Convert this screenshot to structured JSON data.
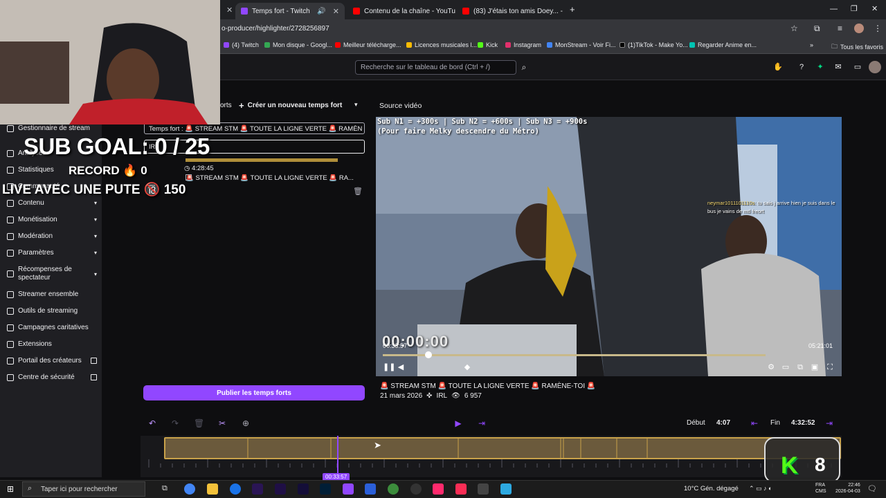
{
  "browser": {
    "tabs": [
      {
        "label": "Temps fort - Twitch",
        "color": "#9147ff",
        "active": true
      },
      {
        "label": "Contenu de la chaîne - YouTub",
        "color": "#ff0000",
        "active": false
      },
      {
        "label": "(83) J'étais ton amis Doey... - Pu",
        "color": "#ff0000",
        "active": false
      }
    ],
    "url": "o-producer/highlighter/2728256897",
    "bookmarks": [
      {
        "label": "(4) Twitch",
        "color": "#9147ff"
      },
      {
        "label": "Mon disque - Googl...",
        "color": "#34a853"
      },
      {
        "label": "Meilleur télécharge...",
        "color": "#ff0000"
      },
      {
        "label": "Licences musicales l...",
        "color": "#fbbc04"
      },
      {
        "label": "Kick",
        "color": "#53fc18"
      },
      {
        "label": "Instagram",
        "color": "#e1306c"
      },
      {
        "label": "MonStream - Voir Fi...",
        "color": "#4285f4"
      },
      {
        "label": "(1)TikTok - Make Yo...",
        "color": "#000000"
      },
      {
        "label": "Regarder Anime en...",
        "color": "#00c4b3"
      }
    ],
    "all_favorites": "Tous les favoris"
  },
  "topbar": {
    "search_placeholder": "Recherche sur le tableau de bord (Ctrl + /)"
  },
  "sidebar": {
    "items": [
      {
        "label": "Gestionnaire de stream",
        "chevron": false
      },
      {
        "label": "Analyses",
        "chevron": false
      },
      {
        "label": "Statistiques",
        "chevron": false
      },
      {
        "label": "Communauté",
        "chevron": false
      },
      {
        "label": "Contenu",
        "chevron": true
      },
      {
        "label": "Monétisation",
        "chevron": true
      },
      {
        "label": "Modération",
        "chevron": true
      },
      {
        "label": "Paramètres",
        "chevron": true
      },
      {
        "label": "Récompenses de spectateur",
        "chevron": true
      },
      {
        "label": "Streamer ensemble",
        "chevron": false
      },
      {
        "label": "Outils de streaming",
        "chevron": false
      },
      {
        "label": "Campagnes caritatives",
        "chevron": false
      },
      {
        "label": "Extensions",
        "chevron": false
      },
      {
        "label": "Portail des créateurs",
        "external": true
      },
      {
        "label": "Centre de sécurité",
        "external": true
      }
    ]
  },
  "highlights": {
    "tab_fragment": "orts",
    "create_label": "Créer un nouveau temps fort",
    "title_field": "Temps fort : 🚨 STREAM STM 🚨 TOUTE LA LIGNE VERTE 🚨 RAMÈN",
    "category_field": "IRL",
    "duration": "4:28:45",
    "item_title": "🚨 STREAM STM 🚨 TOUTE LA LIGNE VERTE 🚨 RA...",
    "publish_label": "Publier les temps forts"
  },
  "video": {
    "source_label": "Source vidéo",
    "sub_line1": "Sub N1 = +300s | Sub N2 = +600s | Sub N3 = +900s",
    "sub_line2": "(Pour faire Melky descendre du Métro)",
    "chat_user": "neymar1011101110s",
    "chat_msg": "tu sais j arrive hien je suis dans le bus je vains de mtl freort",
    "big_time": "00:00:00",
    "current_time": "00:33:57",
    "end_time": "05:21:01",
    "progress": 0.12,
    "title": "🚨 STREAM STM 🚨 TOUTE LA LIGNE VERTE 🚨 RAMÈNE-TOI 🚨",
    "date": "21 mars 2026",
    "category": "IRL",
    "views": "6 957"
  },
  "timeline": {
    "start_label": "Début",
    "start_value": "4:07",
    "end_label": "Fin",
    "end_value": "4:32:52",
    "playhead_label": "00:33:57"
  },
  "overlay": {
    "sub_goal": "SUB GOAL: 0 / 25",
    "record": "RECORD 🔥 0",
    "live": "LIVE AVEC UNE PUTE 🔞 150",
    "kick_count": "8"
  },
  "taskbar": {
    "search_placeholder": "Taper ici pour rechercher",
    "weather": "10°C  Gén. dégagé",
    "lang1": "FRA",
    "lang2": "CMS",
    "time": "22:46",
    "date": "2026-04-03"
  },
  "colors": {
    "accent": "#9147ff",
    "clip": "#c9a24a",
    "kick": "#53fc18"
  }
}
